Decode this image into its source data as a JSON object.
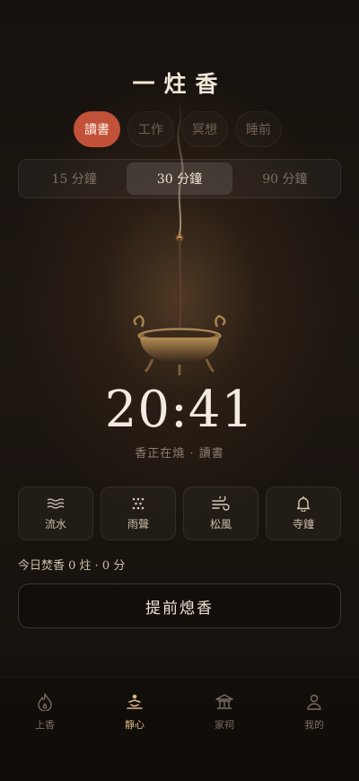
{
  "app": {
    "title": "一炷香"
  },
  "categories": [
    {
      "label": "讀書",
      "active": true
    },
    {
      "label": "工作",
      "active": false
    },
    {
      "label": "冥想",
      "active": false
    },
    {
      "label": "睡前",
      "active": false
    }
  ],
  "durations": [
    {
      "label": "15 分鐘",
      "active": false
    },
    {
      "label": "30 分鐘",
      "active": true
    },
    {
      "label": "90 分鐘",
      "active": false
    }
  ],
  "timer": {
    "time": "20:41",
    "status": "香正在燒 · 讀書"
  },
  "sounds": [
    {
      "label": "流水",
      "icon": "water-waves-icon"
    },
    {
      "label": "雨聲",
      "icon": "rain-dots-icon"
    },
    {
      "label": "松風",
      "icon": "wind-icon"
    },
    {
      "label": "寺鐘",
      "icon": "bell-icon"
    }
  ],
  "today": {
    "text": "今日焚香 0 炷 · 0 分"
  },
  "actions": {
    "extinguish_label": "提前熄香"
  },
  "tabbar": [
    {
      "label": "上香",
      "icon": "flame-icon",
      "active": false
    },
    {
      "label": "靜心",
      "icon": "meditation-icon",
      "active": true
    },
    {
      "label": "家祠",
      "icon": "shrine-icon",
      "active": false
    },
    {
      "label": "我的",
      "icon": "person-icon",
      "active": false
    }
  ],
  "colors": {
    "accent": "#c2513a",
    "tab_active": "#d9b88a",
    "background": "#17120e"
  }
}
